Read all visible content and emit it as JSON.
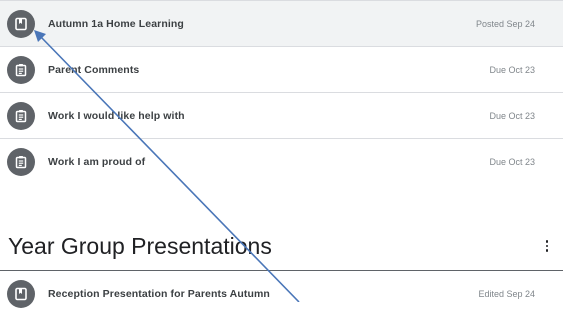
{
  "assignments": [
    {
      "title": "Autumn 1a Home Learning",
      "meta": "Posted Sep 24",
      "icon": "book-icon"
    },
    {
      "title": "Parent Comments",
      "meta": "Due Oct 23",
      "icon": "assignment-icon"
    },
    {
      "title": "Work I would like help with",
      "meta": "Due Oct 23",
      "icon": "assignment-icon"
    },
    {
      "title": "Work I am proud of",
      "meta": "Due Oct 23",
      "icon": "assignment-icon"
    }
  ],
  "section": {
    "title": "Year Group Presentations",
    "more_icon": "more-vertical-icon",
    "items": [
      {
        "title": "Reception Presentation for Parents Autumn",
        "meta": "Edited Sep 24",
        "icon": "book-icon"
      }
    ]
  },
  "colors": {
    "icon_bg": "#5f6368",
    "highlight_row": "#f1f3f4",
    "annotation_arrow": "#4a76b8"
  }
}
